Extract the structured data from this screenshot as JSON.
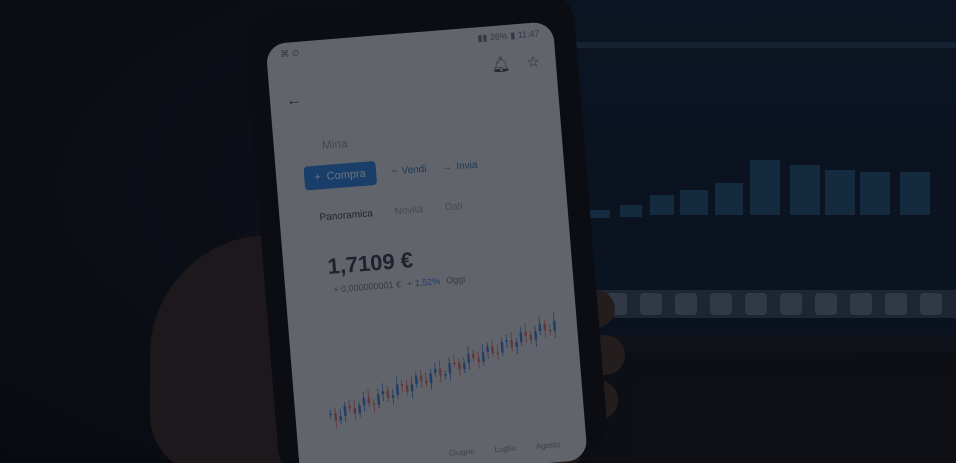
{
  "phone": {
    "status_left": "⌘ ⊙",
    "status_right": "▮▮ 26% ▮ 11:47",
    "asset_name": "Mina",
    "buy_label": "Compra",
    "sell_label": "Vendi",
    "swap_label": "Invia",
    "tabs": [
      "Panoramica",
      "Novità",
      "Dati"
    ],
    "price": "1,7109 €",
    "change_value": "+ 0,000000001 €",
    "change_pct": "+ 1,52%",
    "change_period": "Oggi",
    "x_labels": [
      "Giugno",
      "Luglio",
      "Agosto"
    ],
    "icons": {
      "back": "arrow-left-icon",
      "bell": "bell-icon",
      "star": "star-icon",
      "plus": "plus-icon",
      "minus": "minus-icon",
      "arrow": "arrow-right-icon",
      "trend": "trend-icon"
    }
  },
  "colors": {
    "accent": "#2e7fd6",
    "up": "#3f7ad0",
    "down": "#d06a6a"
  }
}
